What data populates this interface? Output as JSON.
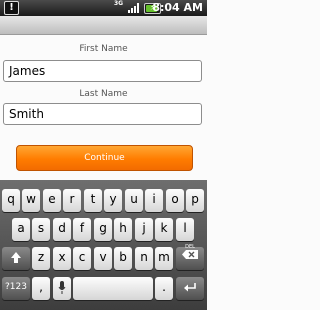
{
  "status_bar": {
    "warning_icon": "warning-icon",
    "network": "3G",
    "time": "8:04 AM"
  },
  "form": {
    "first_name_label": "First Name",
    "first_name_value": "James",
    "last_name_label": "Last Name",
    "last_name_value": "Smith",
    "continue_label": "Continue"
  },
  "keyboard": {
    "row1": [
      "q",
      "w",
      "e",
      "r",
      "t",
      "y",
      "u",
      "i",
      "o",
      "p"
    ],
    "row2": [
      "a",
      "s",
      "d",
      "f",
      "g",
      "h",
      "j",
      "k",
      "l"
    ],
    "row3": [
      "z",
      "x",
      "c",
      "v",
      "b",
      "n",
      "m"
    ],
    "delete_label": "DEL",
    "symbols_label": "?123",
    "comma": ",",
    "period": "."
  },
  "colors": {
    "accent": "#ff8200",
    "battery": "#66c02c"
  }
}
